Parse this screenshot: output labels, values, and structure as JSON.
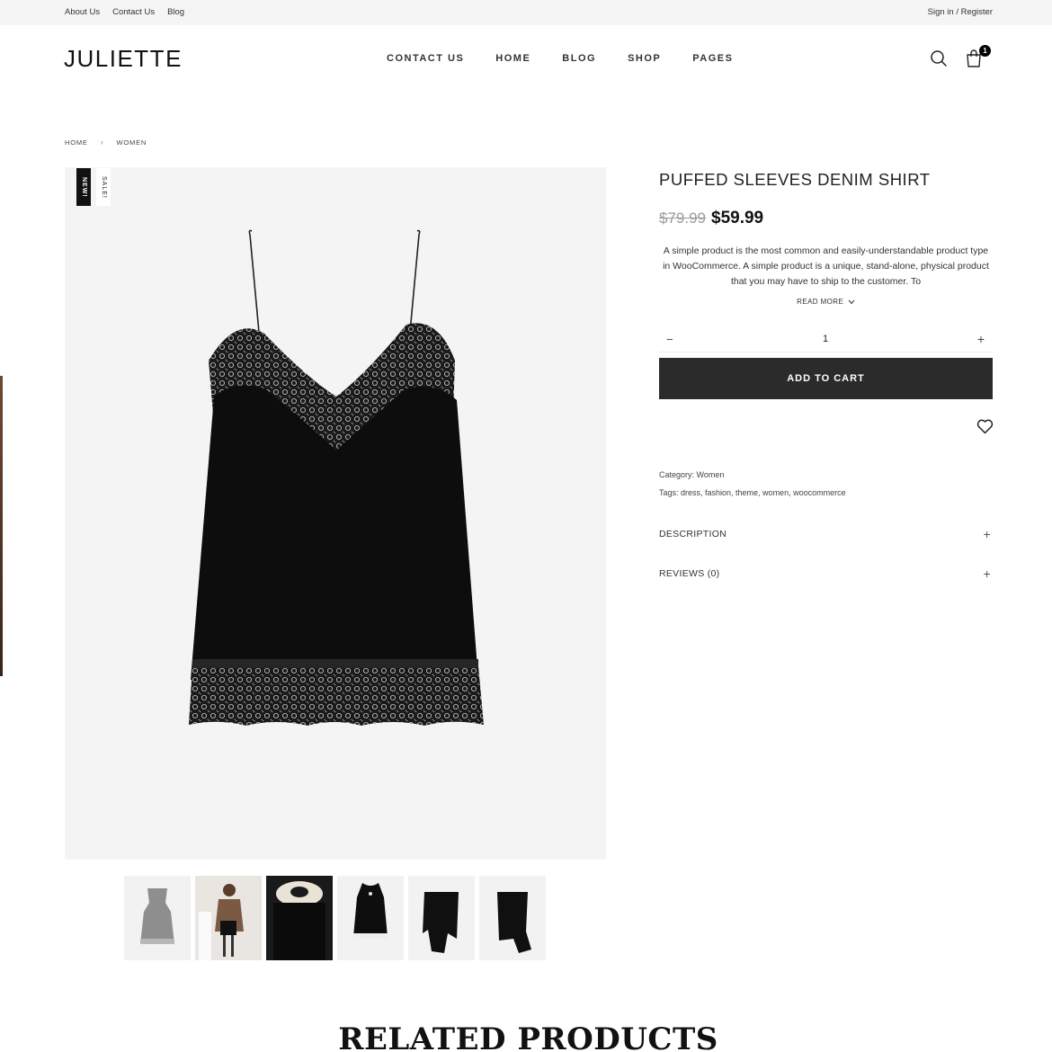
{
  "topbar": {
    "links": [
      "About Us",
      "Contact Us",
      "Blog"
    ],
    "account": "Sign in / Register"
  },
  "header": {
    "logo": "JULIETTE",
    "nav": [
      "CONTACT US",
      "HOME",
      "BLOG",
      "SHOP",
      "PAGES"
    ],
    "cart_count": "1",
    "icons": {
      "search": "search-icon",
      "cart": "shopping-bag-icon"
    }
  },
  "breadcrumb": {
    "home": "HOME",
    "sep": "›",
    "current": "WOMEN"
  },
  "gallery": {
    "badge_new": "NEW!",
    "badge_sale": "SALE!",
    "thumb_count": 6
  },
  "product": {
    "title": "PUFFED SLEEVES DENIM SHIRT",
    "old_price": "$79.99",
    "price": "$59.99",
    "description": "A simple product is the most common and easily-understandable product type in WooCommerce. A simple product is a unique, stand-alone, physical product that you may have to ship to the customer. To",
    "read_more": "READ MORE",
    "quantity": "1",
    "minus": "−",
    "plus": "+",
    "add_to_cart": "ADD TO CART",
    "category": "Category: Women",
    "tags": "Tags: dress, fashion, theme, women, woocommerce",
    "accordion": [
      {
        "label": "DESCRIPTION",
        "toggle": "+"
      },
      {
        "label": "REVIEWS (0)",
        "toggle": "+"
      }
    ]
  },
  "related": {
    "heading": "RELATED PRODUCTS"
  },
  "colors": {
    "button": "#2b2b2b",
    "gallery_bg": "#f4f4f5",
    "topbar_bg": "#f5f5f5"
  }
}
